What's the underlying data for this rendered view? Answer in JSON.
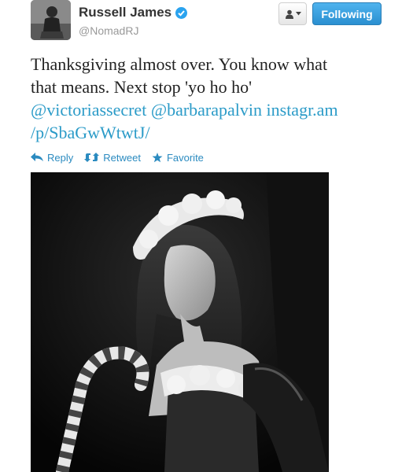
{
  "header": {
    "display_name": "Russell James",
    "username": "@NomadRJ",
    "follow_label": "Following"
  },
  "tweet": {
    "text_line1": "Thanksgiving almost over. You know what",
    "text_line2": "that means. Next stop 'yo ho ho'",
    "mention1": "@victoriassecret",
    "mention2": "@barbarapalvin",
    "link_part1": "instagr.am",
    "link_part2": "/p/SbaGwWtwtJ/"
  },
  "actions": {
    "reply": "Reply",
    "retweet": "Retweet",
    "favorite": "Favorite"
  },
  "colors": {
    "link": "#2b9bc8",
    "action": "#2b8bc0",
    "follow_button": "#3aa0df",
    "verified": "#2aa3ef"
  },
  "icons": [
    "avatar-photo",
    "verified-badge-icon",
    "user-icon",
    "chevron-down-icon",
    "reply-icon",
    "retweet-icon",
    "star-icon"
  ]
}
